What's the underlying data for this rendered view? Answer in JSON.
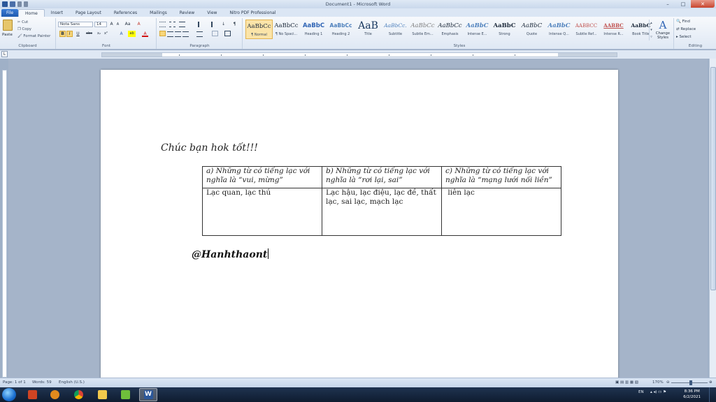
{
  "window": {
    "title": "Document1 - Microsoft Word",
    "minimize": "–",
    "maximize": "□",
    "close": "✕"
  },
  "tabs": [
    {
      "label": "File"
    },
    {
      "label": "Home"
    },
    {
      "label": "Insert"
    },
    {
      "label": "Page Layout"
    },
    {
      "label": "References"
    },
    {
      "label": "Mailings"
    },
    {
      "label": "Review"
    },
    {
      "label": "View"
    },
    {
      "label": "Nitro PDF Professional"
    }
  ],
  "ribbon": {
    "clipboard": {
      "paste": "Paste",
      "cut": "Cut",
      "copy": "Copy",
      "format_painter": "Format Painter",
      "label": "Clipboard"
    },
    "font": {
      "name": "Nota Sans",
      "size": "14",
      "label": "Font",
      "bold": "B",
      "italic": "I",
      "underline": "U",
      "strike": "abc",
      "sub": "x₂",
      "sup": "x²",
      "grow": "A",
      "shrink": "A",
      "case": "Aa",
      "clear": "A",
      "highlight": "ab",
      "color": "A"
    },
    "paragraph": {
      "label": "Paragraph",
      "pilcrow": "¶"
    },
    "styles": {
      "label": "Styles",
      "items": [
        {
          "preview": "AaBbCc",
          "name": "¶ Normal"
        },
        {
          "preview": "AaBbCc",
          "name": "¶ No Spaci..."
        },
        {
          "preview": "AaBbC",
          "name": "Heading 1"
        },
        {
          "preview": "AaBbCc",
          "name": "Heading 2"
        },
        {
          "preview": "AaB",
          "name": "Title"
        },
        {
          "preview": "AaBbCc.",
          "name": "Subtitle"
        },
        {
          "preview": "AaBbCc",
          "name": "Subtle Em..."
        },
        {
          "preview": "AaBbCc",
          "name": "Emphasis"
        },
        {
          "preview": "AaBbC",
          "name": "Intense E..."
        },
        {
          "preview": "AaBbC",
          "name": "Strong"
        },
        {
          "preview": "AaBbC",
          "name": "Quote"
        },
        {
          "preview": "AaBbC",
          "name": "Intense Q..."
        },
        {
          "preview": "AABBCC",
          "name": "Subtle Ref..."
        },
        {
          "preview": "AABBC",
          "name": "Intense R..."
        },
        {
          "preview": "AaBbC",
          "name": "Book Title"
        }
      ],
      "change_styles": "Change Styles"
    },
    "editing": {
      "label": "Editing",
      "find": "Find",
      "replace": "Replace",
      "select": "Select"
    }
  },
  "document": {
    "wish": "Chúc bạn hok tốt!!!",
    "table": {
      "headers": [
        "a) Những từ có  tiếng lạc với nghĩa là “vui, mừng”",
        "b) Những từ có tiếng lạc với nghĩa là “rơi lại, sai”",
        "c) Những từ có tiếng lạc với nghĩa là “mạng lưới nối liền”"
      ],
      "rows": [
        [
          "Lạc quan, lạc thú",
          "Lạc hậu, lạc điệu, lạc đề, thất lạc, sai lạc, mạch lạc",
          " liên lạc"
        ]
      ]
    },
    "signature": "@Hanhthaont"
  },
  "statusbar": {
    "page": "Page: 1 of 1",
    "words": "Words: 59",
    "language": "English (U.S.)",
    "zoom": "170%"
  },
  "taskbar": {
    "lang": "EN",
    "time": "8:36 PM",
    "date": "6/2/2021"
  },
  "colors": {
    "accent": "#2b579a",
    "file_tab": "#1f5bb0"
  }
}
